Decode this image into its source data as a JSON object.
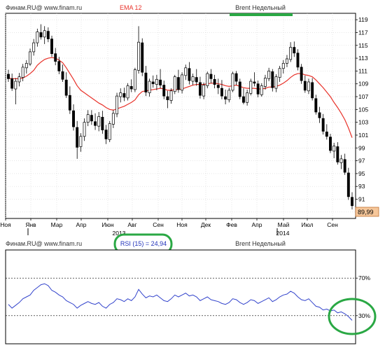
{
  "top_panel": {
    "source": "Финам.RU@  www.finam.ru",
    "indicator": "EMA 12",
    "title": "Brent Недельный",
    "last_price": "89,99"
  },
  "bottom_panel": {
    "source": "Финам.RU@  www.finam.ru",
    "indicator": "RSI (15) = 24,94",
    "title": "Brent Недельный"
  },
  "colors": {
    "candle_up": "#ffffff",
    "candle_down": "#000000",
    "ema": "#e8322a",
    "rsi": "#3344cc",
    "highlight": "#2aa844",
    "price_tag": "#f6c79a"
  },
  "chart_data": [
    {
      "type": "candlestick",
      "title": "Brent Недельный",
      "ylim": [
        88,
        120
      ],
      "y_ticks": [
        89,
        91,
        93,
        95,
        97,
        99,
        101,
        103,
        105,
        107,
        109,
        111,
        113,
        115,
        117,
        119
      ],
      "x_tick_labels": [
        "Ноя",
        "Янв",
        "Мар",
        "Апр",
        "Июн",
        "Авг",
        "Сен",
        "Ноя",
        "Дек",
        "Фев",
        "Апр",
        "Май",
        "Июл",
        "Сен"
      ],
      "x_year_labels": [
        "2013",
        "2014"
      ],
      "grid": true,
      "last_value": 89.99,
      "ohlc": [
        [
          110.5,
          111.2,
          109.3,
          109.8
        ],
        [
          109.8,
          110.6,
          107.9,
          108.3
        ],
        [
          108.2,
          109.9,
          105.8,
          109.4
        ],
        [
          109.3,
          110.7,
          108.6,
          110.1
        ],
        [
          110,
          112.1,
          109.4,
          111.6
        ],
        [
          111.5,
          112.7,
          110.6,
          112.2
        ],
        [
          112.1,
          114.5,
          111.8,
          114
        ],
        [
          114,
          116,
          113.4,
          115.4
        ],
        [
          115.4,
          117.6,
          114.8,
          117.1
        ],
        [
          117,
          118.3,
          115.9,
          116.3
        ],
        [
          116.3,
          118,
          115.2,
          117.3
        ],
        [
          117.2,
          117.8,
          115.5,
          116
        ],
        [
          116,
          116.5,
          113.2,
          113.7
        ],
        [
          113.7,
          114.6,
          111.9,
          112.5
        ],
        [
          112.5,
          113.2,
          110.5,
          111
        ],
        [
          110.9,
          112,
          109.3,
          109.7
        ],
        [
          109.6,
          110.8,
          106.8,
          107.2
        ],
        [
          107.2,
          108.6,
          104.3,
          104.9
        ],
        [
          104.8,
          105.8,
          101.7,
          102.3
        ],
        [
          102.2,
          103.2,
          97.3,
          99.1
        ],
        [
          99.2,
          101.3,
          98.4,
          100.8
        ],
        [
          100.8,
          103.6,
          100.1,
          103
        ],
        [
          103,
          104.9,
          102.4,
          104.2
        ],
        [
          104.1,
          104.9,
          102.6,
          103.2
        ],
        [
          103.1,
          104.4,
          101.8,
          102.5
        ],
        [
          102.4,
          104.6,
          101.6,
          103.9
        ],
        [
          103.8,
          104.8,
          101.2,
          101.8
        ],
        [
          101.8,
          102.6,
          99.6,
          100.4
        ],
        [
          100.3,
          103.2,
          99.9,
          102.8
        ],
        [
          102.7,
          104.9,
          102.1,
          104.4
        ],
        [
          104.3,
          107.6,
          103.8,
          107.1
        ],
        [
          107,
          108.3,
          106.1,
          107.6
        ],
        [
          107.5,
          108.4,
          106.3,
          106.9
        ],
        [
          106.8,
          109.1,
          106.4,
          108.7
        ],
        [
          108.6,
          109.7,
          107.7,
          108.2
        ],
        [
          108.1,
          111.5,
          107.7,
          111.2
        ],
        [
          111.1,
          118,
          110.6,
          115.5
        ],
        [
          115.4,
          116.1,
          110.2,
          110.8
        ],
        [
          110.7,
          111.8,
          107.1,
          107.7
        ],
        [
          107.6,
          109.8,
          107,
          109.4
        ],
        [
          109.3,
          110.3,
          108.4,
          109
        ],
        [
          108.9,
          110.4,
          108,
          109.7
        ],
        [
          109.6,
          111.3,
          108.3,
          108.8
        ],
        [
          108.8,
          109.5,
          106.6,
          107.1
        ],
        [
          107,
          107.9,
          105.2,
          106.5
        ],
        [
          106.4,
          108.3,
          105.9,
          107.9
        ],
        [
          107.8,
          110.4,
          107.4,
          110.1
        ],
        [
          110,
          111.2,
          107.6,
          108.1
        ],
        [
          108,
          110.8,
          107.5,
          110.4
        ],
        [
          110.3,
          112,
          109.6,
          111.5
        ],
        [
          111.4,
          112.4,
          108.9,
          109.5
        ],
        [
          109.4,
          110.6,
          108.8,
          110.1
        ],
        [
          110,
          111.3,
          108.7,
          109.3
        ],
        [
          109.2,
          110.1,
          106.7,
          107.2
        ],
        [
          107.1,
          109.2,
          106.6,
          108.8
        ],
        [
          108.7,
          110.9,
          108.3,
          110.6
        ],
        [
          110.5,
          111.3,
          109.1,
          109.8
        ],
        [
          109.7,
          110.4,
          108.3,
          108.9
        ],
        [
          108.8,
          109.8,
          107.4,
          108.4
        ],
        [
          108.3,
          109.6,
          106.6,
          107.1
        ],
        [
          107,
          108.1,
          105.8,
          106.6
        ],
        [
          106.5,
          108.4,
          106.1,
          108
        ],
        [
          108,
          110.9,
          107.7,
          110.6
        ],
        [
          110.6,
          111,
          108.8,
          109.4
        ],
        [
          109.3,
          109.8,
          106.6,
          107
        ],
        [
          107,
          108.3,
          105.8,
          106.1
        ],
        [
          106.1,
          108.1,
          105.6,
          107.6
        ],
        [
          107.5,
          109.8,
          107.2,
          109.4
        ],
        [
          109.3,
          110.8,
          108.6,
          109.1
        ],
        [
          109,
          109.5,
          106.9,
          107.4
        ],
        [
          107.3,
          109.1,
          107,
          108.7
        ],
        [
          108.6,
          110.4,
          108.1,
          109.9
        ],
        [
          109.8,
          111.5,
          109.4,
          111
        ],
        [
          110.9,
          111.3,
          107.8,
          108.4
        ],
        [
          108.3,
          110.5,
          107.7,
          110.1
        ],
        [
          110,
          111.8,
          109.3,
          111.4
        ],
        [
          111.4,
          112.7,
          110.6,
          112.2
        ],
        [
          112.2,
          113.5,
          111.6,
          112.9
        ],
        [
          112.8,
          115.5,
          112.4,
          114.7
        ],
        [
          114.7,
          115.6,
          113.2,
          113.8
        ],
        [
          113.8,
          114.4,
          111.1,
          111.6
        ],
        [
          111.6,
          112.1,
          109,
          109.5
        ],
        [
          109.4,
          110.3,
          107.6,
          108
        ],
        [
          107.9,
          109.8,
          107.4,
          109.3
        ],
        [
          109.2,
          109.9,
          106.4,
          106.8
        ],
        [
          106.7,
          107.3,
          104.2,
          104.6
        ],
        [
          104.5,
          105.4,
          102.9,
          103.7
        ],
        [
          103.6,
          104.3,
          101.1,
          101.6
        ],
        [
          101.5,
          102.7,
          100.3,
          100.8
        ],
        [
          100.7,
          101.2,
          98.2,
          98.6
        ],
        [
          98.5,
          99.8,
          97.4,
          99.3
        ],
        [
          99.2,
          99.9,
          96.4,
          96.8
        ],
        [
          96.7,
          97.9,
          95.7,
          97.3
        ],
        [
          97.2,
          98.1,
          94.8,
          95.2
        ],
        [
          95.1,
          95.9,
          90.9,
          91.4
        ],
        [
          91.3,
          92.1,
          89.4,
          89.99
        ]
      ],
      "series": [
        {
          "name": "EMA 12",
          "values": [
            109.9,
            109.8,
            109.8,
            109.8,
            109.9,
            110.2,
            110.6,
            111.1,
            111.9,
            112.4,
            112.8,
            113,
            113.1,
            113,
            112.7,
            112.3,
            111.5,
            110.6,
            109.7,
            108.7,
            108,
            107.6,
            107.2,
            106.8,
            106.4,
            106,
            105.7,
            105.3,
            105,
            104.9,
            105.1,
            105.3,
            105.5,
            105.8,
            106.1,
            106.5,
            107.3,
            107.8,
            107.9,
            108,
            108.1,
            108.2,
            108.3,
            108.2,
            108,
            108,
            108.1,
            108.1,
            108.2,
            108.4,
            108.6,
            108.8,
            108.9,
            108.9,
            108.9,
            109,
            109.1,
            109.1,
            109,
            108.9,
            108.7,
            108.6,
            108.7,
            108.8,
            108.6,
            108.4,
            108.3,
            108.3,
            108.3,
            108.2,
            108.2,
            108.3,
            108.5,
            108.5,
            108.6,
            108.8,
            109.1,
            109.5,
            110,
            110.4,
            110.6,
            110.6,
            110.4,
            110.3,
            110.1,
            109.6,
            109,
            108.4,
            107.7,
            107,
            106.1,
            105.3,
            104.4,
            103.4,
            102.1,
            100.6
          ]
        }
      ]
    },
    {
      "type": "line",
      "title": "Brent Недельный",
      "ylim": [
        0,
        100
      ],
      "y_ticks": [
        30,
        70
      ],
      "y_tick_labels": [
        "30%",
        "70%"
      ],
      "series": [
        {
          "name": "RSI (15)",
          "values": [
            42,
            38,
            41,
            44,
            48,
            50,
            52,
            57,
            60,
            63,
            64,
            62,
            57,
            55,
            52,
            50,
            46,
            44,
            42,
            38,
            41,
            43,
            45,
            43,
            42,
            44,
            40,
            38,
            42,
            44,
            48,
            47,
            45,
            48,
            46,
            50,
            58,
            53,
            49,
            51,
            50,
            52,
            49,
            46,
            45,
            48,
            52,
            50,
            52,
            54,
            51,
            52,
            50,
            46,
            48,
            50,
            47,
            46,
            45,
            43,
            42,
            44,
            48,
            47,
            44,
            42,
            44,
            47,
            46,
            43,
            45,
            47,
            49,
            45,
            47,
            50,
            52,
            53,
            56,
            54,
            50,
            47,
            46,
            48,
            44,
            40,
            39,
            36,
            37,
            35,
            36,
            33,
            34,
            32,
            29,
            25
          ]
        }
      ],
      "current_value": 24.94
    }
  ]
}
